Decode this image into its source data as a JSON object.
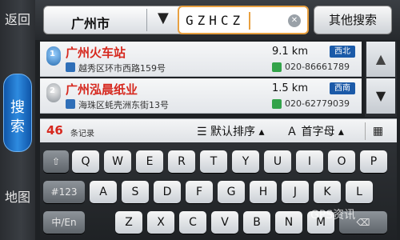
{
  "nav": {
    "back": "返回",
    "search": "搜索",
    "map": "地图"
  },
  "search": {
    "city": "广州市",
    "city_arrow": "▼",
    "query": "GZHCZ",
    "clear_icon": "✕",
    "other_search": "其他搜索"
  },
  "results": [
    {
      "index": "1",
      "name": "广州火车站",
      "distance": "9.1 km",
      "direction": "西北",
      "address": "越秀区环市西路159号",
      "phone": "020-86661789"
    },
    {
      "index": "2",
      "name": "广州泓晨纸业",
      "distance": "1.5 km",
      "direction": "西南",
      "address": "海珠区蚝壳洲东街13号",
      "phone": "020-62779039"
    }
  ],
  "scroll": {
    "up": "▲",
    "down": "▼"
  },
  "status": {
    "count": "46",
    "count_label": "条记录",
    "sort_default": "☰ 默认排序 ▴",
    "sort_letter": "Ａ 首字母 ▴",
    "keyboard_icon": "▦"
  },
  "keyboard": {
    "row1": [
      "Q",
      "W",
      "E",
      "R",
      "T",
      "Y",
      "U",
      "I",
      "O",
      "P"
    ],
    "row2": [
      "A",
      "S",
      "D",
      "F",
      "G",
      "H",
      "J",
      "K",
      "L"
    ],
    "row3": [
      "Z",
      "X",
      "C",
      "V",
      "B",
      "N",
      "M"
    ],
    "shift": "⇧",
    "numeric": "#123",
    "lang": "中/En",
    "delete": "⌫"
  },
  "watermark": "GPS资讯",
  "colors": {
    "accent_red": "#d6281e",
    "nav_active": "#1b6fcf",
    "dir_badge": "#1b5aa8"
  }
}
